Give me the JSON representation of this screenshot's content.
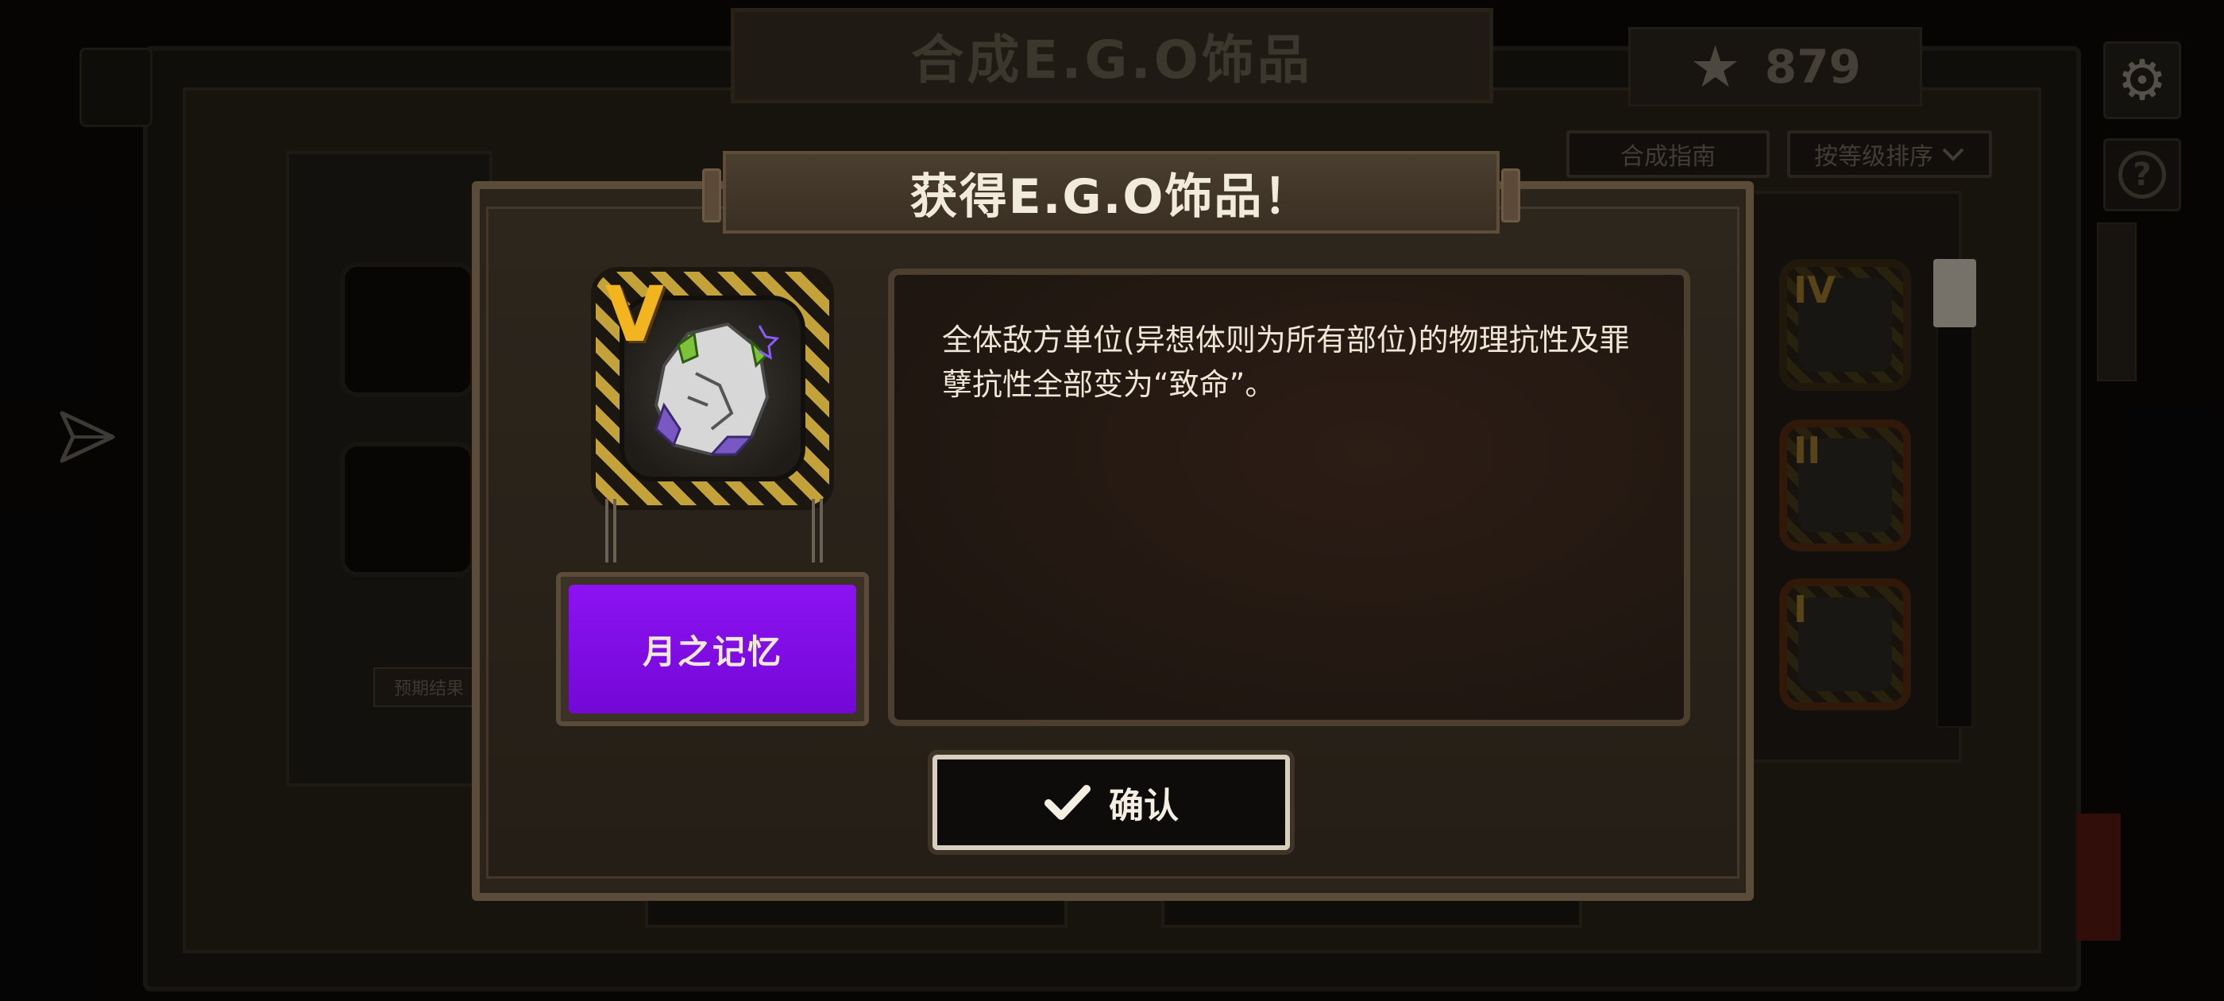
{
  "screen": {
    "title": "合成E.G.O饰品",
    "currency_amount": "879"
  },
  "toolbar": {
    "guide_label": "合成指南",
    "sort_label": "按等级排序"
  },
  "left_panel": {
    "expected_result_label": "预期结果"
  },
  "inventory": {
    "items": [
      {
        "rank": "IV"
      },
      {
        "rank": "II"
      },
      {
        "rank": "I"
      }
    ]
  },
  "dialog": {
    "title": "获得E.G.O饰品！",
    "item": {
      "rank": "V",
      "name": "月之记忆",
      "name_plate_color": "#8c12f2",
      "rank_color": "#f2b51f",
      "description": "全体敌方单位(异想体则为所有部位)的物理抗性及罪孽抗性全部变为“致命”。"
    },
    "confirm_label": "确认"
  },
  "icons": {
    "currency": "star-icon",
    "settings": "gear-icon",
    "help": "question-icon",
    "confirm": "checkmark-icon",
    "sort": "chevron-down-icon",
    "left": "send-icon"
  }
}
